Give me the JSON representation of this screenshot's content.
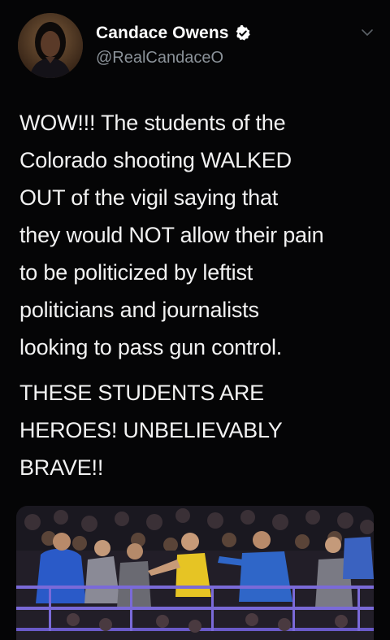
{
  "tweet": {
    "display_name": "Candace Owens",
    "handle": "@RealCandaceO",
    "verified": true,
    "paragraphs": [
      "WOW!!! The students of the\nColorado shooting WALKED\nOUT of the vigil saying that\nthey would NOT allow their pain\nto be politicized by leftist\npoliticians and journalists\nlooking to pass gun control.",
      "THESE STUDENTS ARE\nHEROES! UNBELIEVABLY\nBRAVE!!"
    ]
  },
  "icons": {
    "verified": "verified-badge-icon",
    "menu": "chevron-down-icon"
  },
  "colors": {
    "background": "#050506",
    "text": "#f2f2f2",
    "secondary_text": "#8b9299",
    "verified_badge": "#ffffff"
  }
}
